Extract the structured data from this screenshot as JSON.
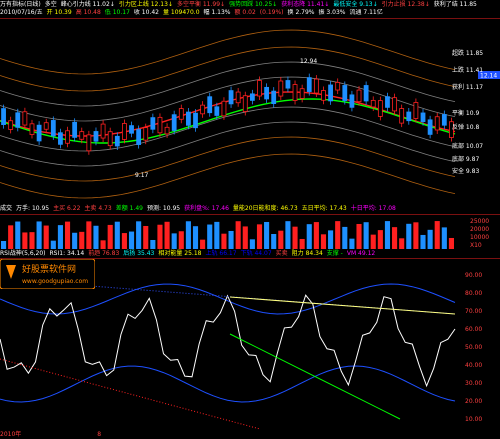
{
  "topbar": {
    "title": "万有指标(日线)",
    "segments": [
      {
        "text": "多空",
        "color": "#ffffff"
      },
      {
        "text": "峰心引力线 11.02↓",
        "color": "#ffffff"
      },
      {
        "text": "引力区上线 12.13↓",
        "color": "#ffff00"
      },
      {
        "text": "多空平衡 11.99↓",
        "color": "#ff4040"
      },
      {
        "text": "强势回踩 10.25↓",
        "color": "#00ff00"
      },
      {
        "text": "获利态降 11.41↓",
        "color": "#ff00ff"
      },
      {
        "text": "最低安全 9.13↓",
        "color": "#00ffff"
      },
      {
        "text": "引力止损 12.38↓",
        "color": "#ff4040"
      },
      {
        "text": "获利了结 11.85",
        "color": "#ffffff"
      }
    ]
  },
  "dateline": {
    "segments": [
      {
        "text": "2010/07/16/五",
        "color": "#ffffff"
      },
      {
        "text": "开 10.39",
        "color": "#ffff00"
      },
      {
        "text": "高 10.48",
        "color": "#ff4040"
      },
      {
        "text": "低 10.17",
        "color": "#00ff00"
      },
      {
        "text": "收 10.42",
        "color": "#ffffff"
      },
      {
        "text": "量 109470.0",
        "color": "#ffff00"
      },
      {
        "text": "幅 1.13%",
        "color": "#ffffff"
      },
      {
        "text": "额 0.02",
        "color": "#ff4040"
      },
      {
        "text": "(0.19%)",
        "color": "#ff4040"
      },
      {
        "text": "换 2.79%",
        "color": "#ffffff"
      },
      {
        "text": "振 3.03%",
        "color": "#ffffff"
      },
      {
        "text": "流通 7.11亿",
        "color": "#ffffff"
      }
    ]
  },
  "price_labels": [
    {
      "text": "超跌 11.85",
      "color": "#ffffff"
    },
    {
      "text": "上跌 11.41",
      "color": "#ffffff"
    },
    {
      "text": "获利 11.17",
      "color": "#ffffff"
    },
    {
      "text": "平衡 10.9",
      "color": "#ffffff"
    },
    {
      "text": "反弹 10.8",
      "color": "#ffffff"
    },
    {
      "text": "底部 10.07",
      "color": "#ffffff"
    },
    {
      "text": "底部 9.87",
      "color": "#ffffff"
    },
    {
      "text": "安全 9.83",
      "color": "#ffffff"
    }
  ],
  "price_annotations": {
    "high": "12.94",
    "low": "9.17",
    "current": "12.14"
  },
  "volume_header": {
    "segments": [
      {
        "text": "成交",
        "color": "#ffffff"
      },
      {
        "text": "万手: 10.95",
        "color": "#ffffff"
      },
      {
        "text": "主买 6.22",
        "color": "#ff4040"
      },
      {
        "text": "主卖 4.73",
        "color": "#ff4040"
      },
      {
        "text": "差额 1.49",
        "color": "#00ff00"
      },
      {
        "text": "预测: 10.95",
        "color": "#ffffff"
      },
      {
        "text": "获利盘%: 17.46",
        "color": "#ff00ff"
      },
      {
        "text": "量能20日能和度: 46.73",
        "color": "#ffff00"
      },
      {
        "text": "五日平均: 17.43",
        "color": "#ffff00"
      },
      {
        "text": "十日平均: 17.08",
        "color": "#ff00ff"
      }
    ]
  },
  "volume_axis": [
    "25000",
    "20000",
    "10000",
    "X10"
  ],
  "indicator_header": {
    "segments": [
      {
        "text": "RSI战神(5,6,20)",
        "color": "#ffffff"
      },
      {
        "text": "RSI1: 34.14",
        "color": "#ffffff"
      },
      {
        "text": "前趋 76.83",
        "color": "#ff4040"
      },
      {
        "text": "后扬 35.43",
        "color": "#00ffff"
      },
      {
        "text": "相对能量 25.18",
        "color": "#ffff00"
      },
      {
        "text": "上轨 66.17",
        "color": "#0000ff"
      },
      {
        "text": "下轨 44.07",
        "color": "#0000ff"
      },
      {
        "text": "买卖",
        "color": "#ff4040"
      },
      {
        "text": "阻力 84.34",
        "color": "#ffff00"
      },
      {
        "text": "支撑 -",
        "color": "#00ff00"
      },
      {
        "text": "VM 49.12",
        "color": "#ff00ff"
      }
    ]
  },
  "indicator_axis": [
    "90.00",
    "80.00",
    "70.00",
    "60.00",
    "50.00",
    "40.00",
    "30.00",
    "20.00",
    "10.00"
  ],
  "bottom_axis": {
    "label": "2010年",
    "month": "8"
  },
  "watermark": {
    "title": "好股票软件网",
    "url": "www.goodgupiao.com"
  },
  "colors": {
    "up": "#ff2020",
    "down": "#1e90ff",
    "band": "#cc7a00",
    "mid_red": "#ff2020",
    "mid_green": "#00ff00"
  }
}
